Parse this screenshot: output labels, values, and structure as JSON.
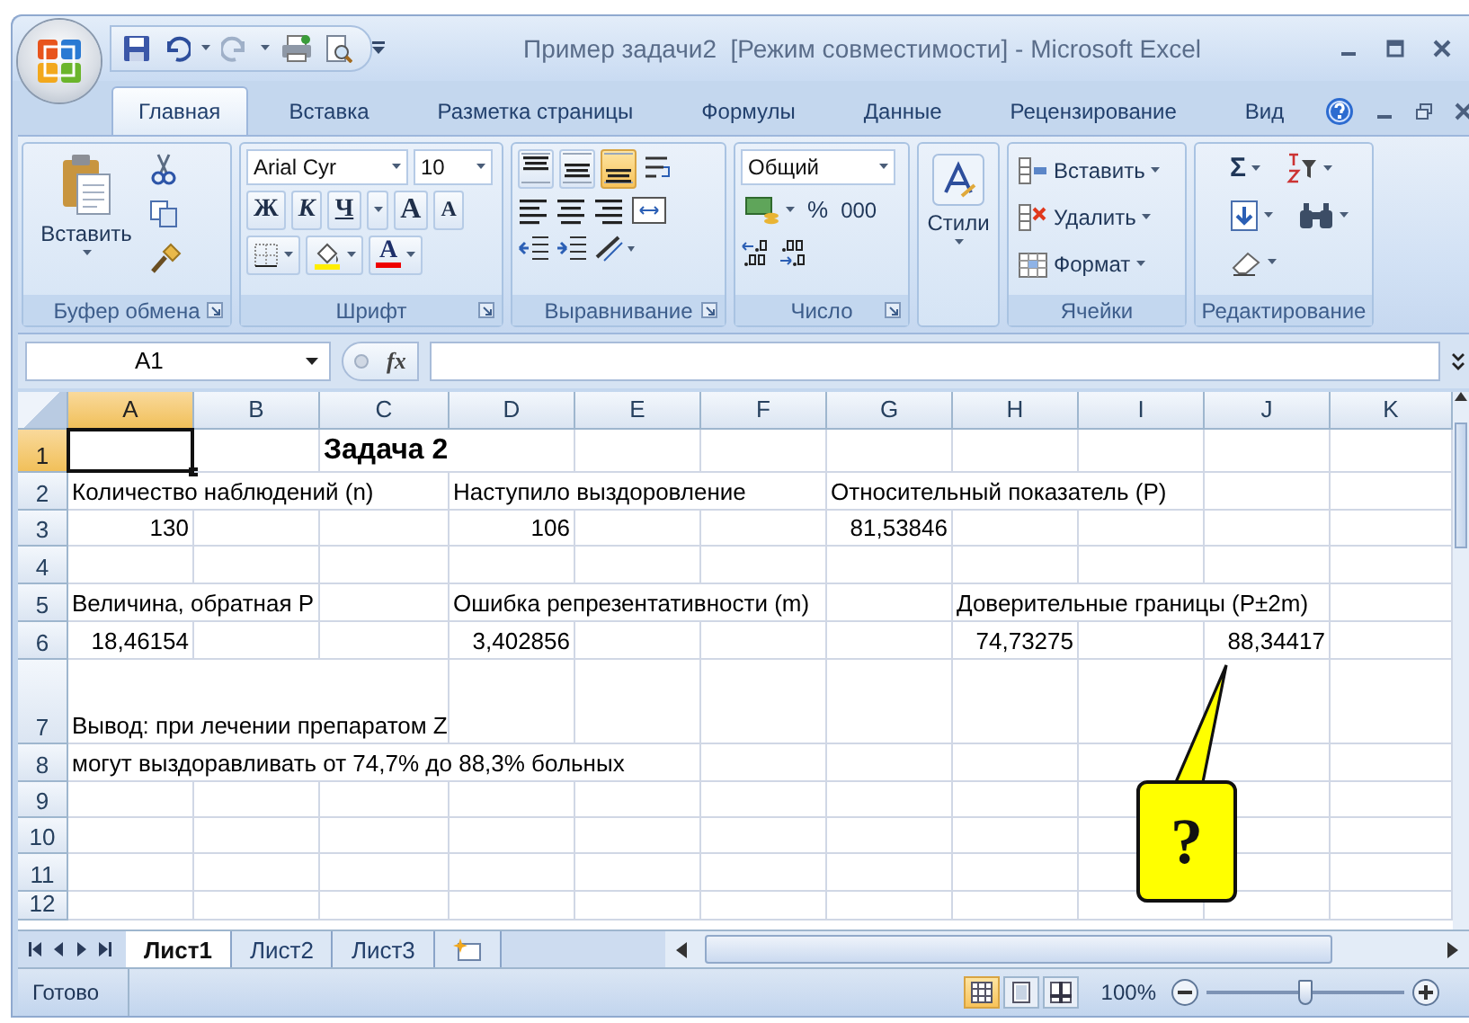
{
  "window": {
    "title": "Пример задачи2  [Режим совместимости] - Microsoft Excel"
  },
  "tabs": [
    {
      "label": "Главная",
      "selected": true
    },
    {
      "label": "Вставка",
      "selected": false
    },
    {
      "label": "Разметка страницы",
      "selected": false
    },
    {
      "label": "Формулы",
      "selected": false
    },
    {
      "label": "Данные",
      "selected": false
    },
    {
      "label": "Рецензирование",
      "selected": false
    },
    {
      "label": "Вид",
      "selected": false
    }
  ],
  "ribbon": {
    "clipboard": {
      "label": "Буфер обмена",
      "paste": "Вставить"
    },
    "font": {
      "label": "Шрифт",
      "font_name": "Arial Cyr",
      "font_size": "10",
      "bold": "Ж",
      "italic": "К",
      "underline": "Ч",
      "grow": "A",
      "shrink": "A",
      "font_color": "A"
    },
    "alignment": {
      "label": "Выравнивание",
      "vertical": [
        {
          "selected": false
        },
        {
          "selected": false
        },
        {
          "selected": true
        }
      ]
    },
    "number": {
      "label": "Число",
      "format": "Общий",
      "percent": "%",
      "thousands": "000"
    },
    "styles": {
      "label": "Стили"
    },
    "cells": {
      "label": "Ячейки",
      "buttons": [
        "Вставить",
        "Удалить",
        "Формат"
      ]
    },
    "editing": {
      "label": "Редактирование",
      "sum": "Σ"
    }
  },
  "formula_bar": {
    "name_box": "A1",
    "fx": "fx"
  },
  "sheet": {
    "columns": [
      {
        "label": "A",
        "selected": true
      },
      {
        "label": "B",
        "selected": false
      },
      {
        "label": "C",
        "selected": false
      },
      {
        "label": "D",
        "selected": false
      },
      {
        "label": "E",
        "selected": false
      },
      {
        "label": "F",
        "selected": false
      },
      {
        "label": "G",
        "selected": false
      },
      {
        "label": "H",
        "selected": false
      },
      {
        "label": "I",
        "selected": false
      },
      {
        "label": "J",
        "selected": false
      },
      {
        "label": "K",
        "selected": false
      }
    ],
    "rows": [
      {
        "label": "1",
        "selected": true,
        "cells": [
          {
            "selected": true
          },
          null,
          {
            "kind": "title",
            "text": "Задача 2"
          },
          null,
          null,
          null,
          null,
          null,
          null,
          null,
          null
        ]
      },
      {
        "label": "2",
        "selected": false,
        "cells": [
          {
            "kind": "text",
            "text": "Количество наблюдений (n)"
          },
          null,
          null,
          {
            "kind": "text",
            "text": "Наступило выздоровление"
          },
          null,
          null,
          {
            "kind": "text",
            "text": "Относительный показатель (P)"
          },
          null,
          null,
          null,
          null
        ]
      },
      {
        "label": "3",
        "selected": false,
        "cells": [
          {
            "kind": "number",
            "text": "130"
          },
          null,
          null,
          {
            "kind": "number",
            "text": "106"
          },
          null,
          null,
          {
            "kind": "number",
            "text": "81,53846"
          },
          null,
          null,
          null,
          null
        ]
      },
      {
        "label": "4",
        "selected": false,
        "cells": [
          null,
          null,
          null,
          null,
          null,
          null,
          null,
          null,
          null,
          null,
          null
        ]
      },
      {
        "label": "5",
        "selected": false,
        "cells": [
          {
            "kind": "text",
            "text": "Величина, обратная P"
          },
          null,
          null,
          {
            "kind": "text",
            "text": "Ошибка репрезентативности (m)"
          },
          null,
          null,
          null,
          {
            "kind": "text",
            "text": "Доверительные границы (P±2m)"
          },
          null,
          null,
          null
        ]
      },
      {
        "label": "6",
        "selected": false,
        "cells": [
          {
            "kind": "number",
            "text": "18,46154"
          },
          null,
          null,
          {
            "kind": "number",
            "text": "3,402856"
          },
          null,
          null,
          null,
          {
            "kind": "number",
            "text": "74,73275"
          },
          null,
          {
            "kind": "number",
            "text": "88,34417"
          },
          null
        ]
      },
      {
        "label": "7",
        "selected": false,
        "cells": [
          {
            "kind": "text",
            "text": "Вывод: при лечении препаратом Z"
          },
          null,
          null,
          null,
          null,
          null,
          null,
          null,
          null,
          null,
          null
        ]
      },
      {
        "label": "8",
        "selected": false,
        "cells": [
          {
            "kind": "text",
            "text": "могут выздоравливать от 74,7% до 88,3% больных"
          },
          null,
          null,
          null,
          null,
          null,
          null,
          null,
          null,
          null,
          null
        ]
      },
      {
        "label": "9",
        "selected": false,
        "cells": [
          null,
          null,
          null,
          null,
          null,
          null,
          null,
          null,
          null,
          null,
          null
        ]
      },
      {
        "label": "10",
        "selected": false,
        "cells": [
          null,
          null,
          null,
          null,
          null,
          null,
          null,
          null,
          null,
          null,
          null
        ]
      },
      {
        "label": "11",
        "selected": false,
        "cells": [
          null,
          null,
          null,
          null,
          null,
          null,
          null,
          null,
          null,
          null,
          null
        ]
      },
      {
        "label": "12",
        "selected": false,
        "cells": [
          null,
          null,
          null,
          null,
          null,
          null,
          null,
          null,
          null,
          null,
          null
        ]
      }
    ],
    "callout": {
      "text": "?"
    }
  },
  "sheet_tabs": [
    {
      "label": "Лист1",
      "selected": true
    },
    {
      "label": "Лист2",
      "selected": false
    },
    {
      "label": "Лист3",
      "selected": false
    }
  ],
  "status_bar": {
    "status": "Готово",
    "views": [
      {
        "selected": true
      },
      {
        "selected": false
      },
      {
        "selected": false
      }
    ],
    "zoom": "100%",
    "zoom_slider": {
      "level": 0.5
    }
  }
}
